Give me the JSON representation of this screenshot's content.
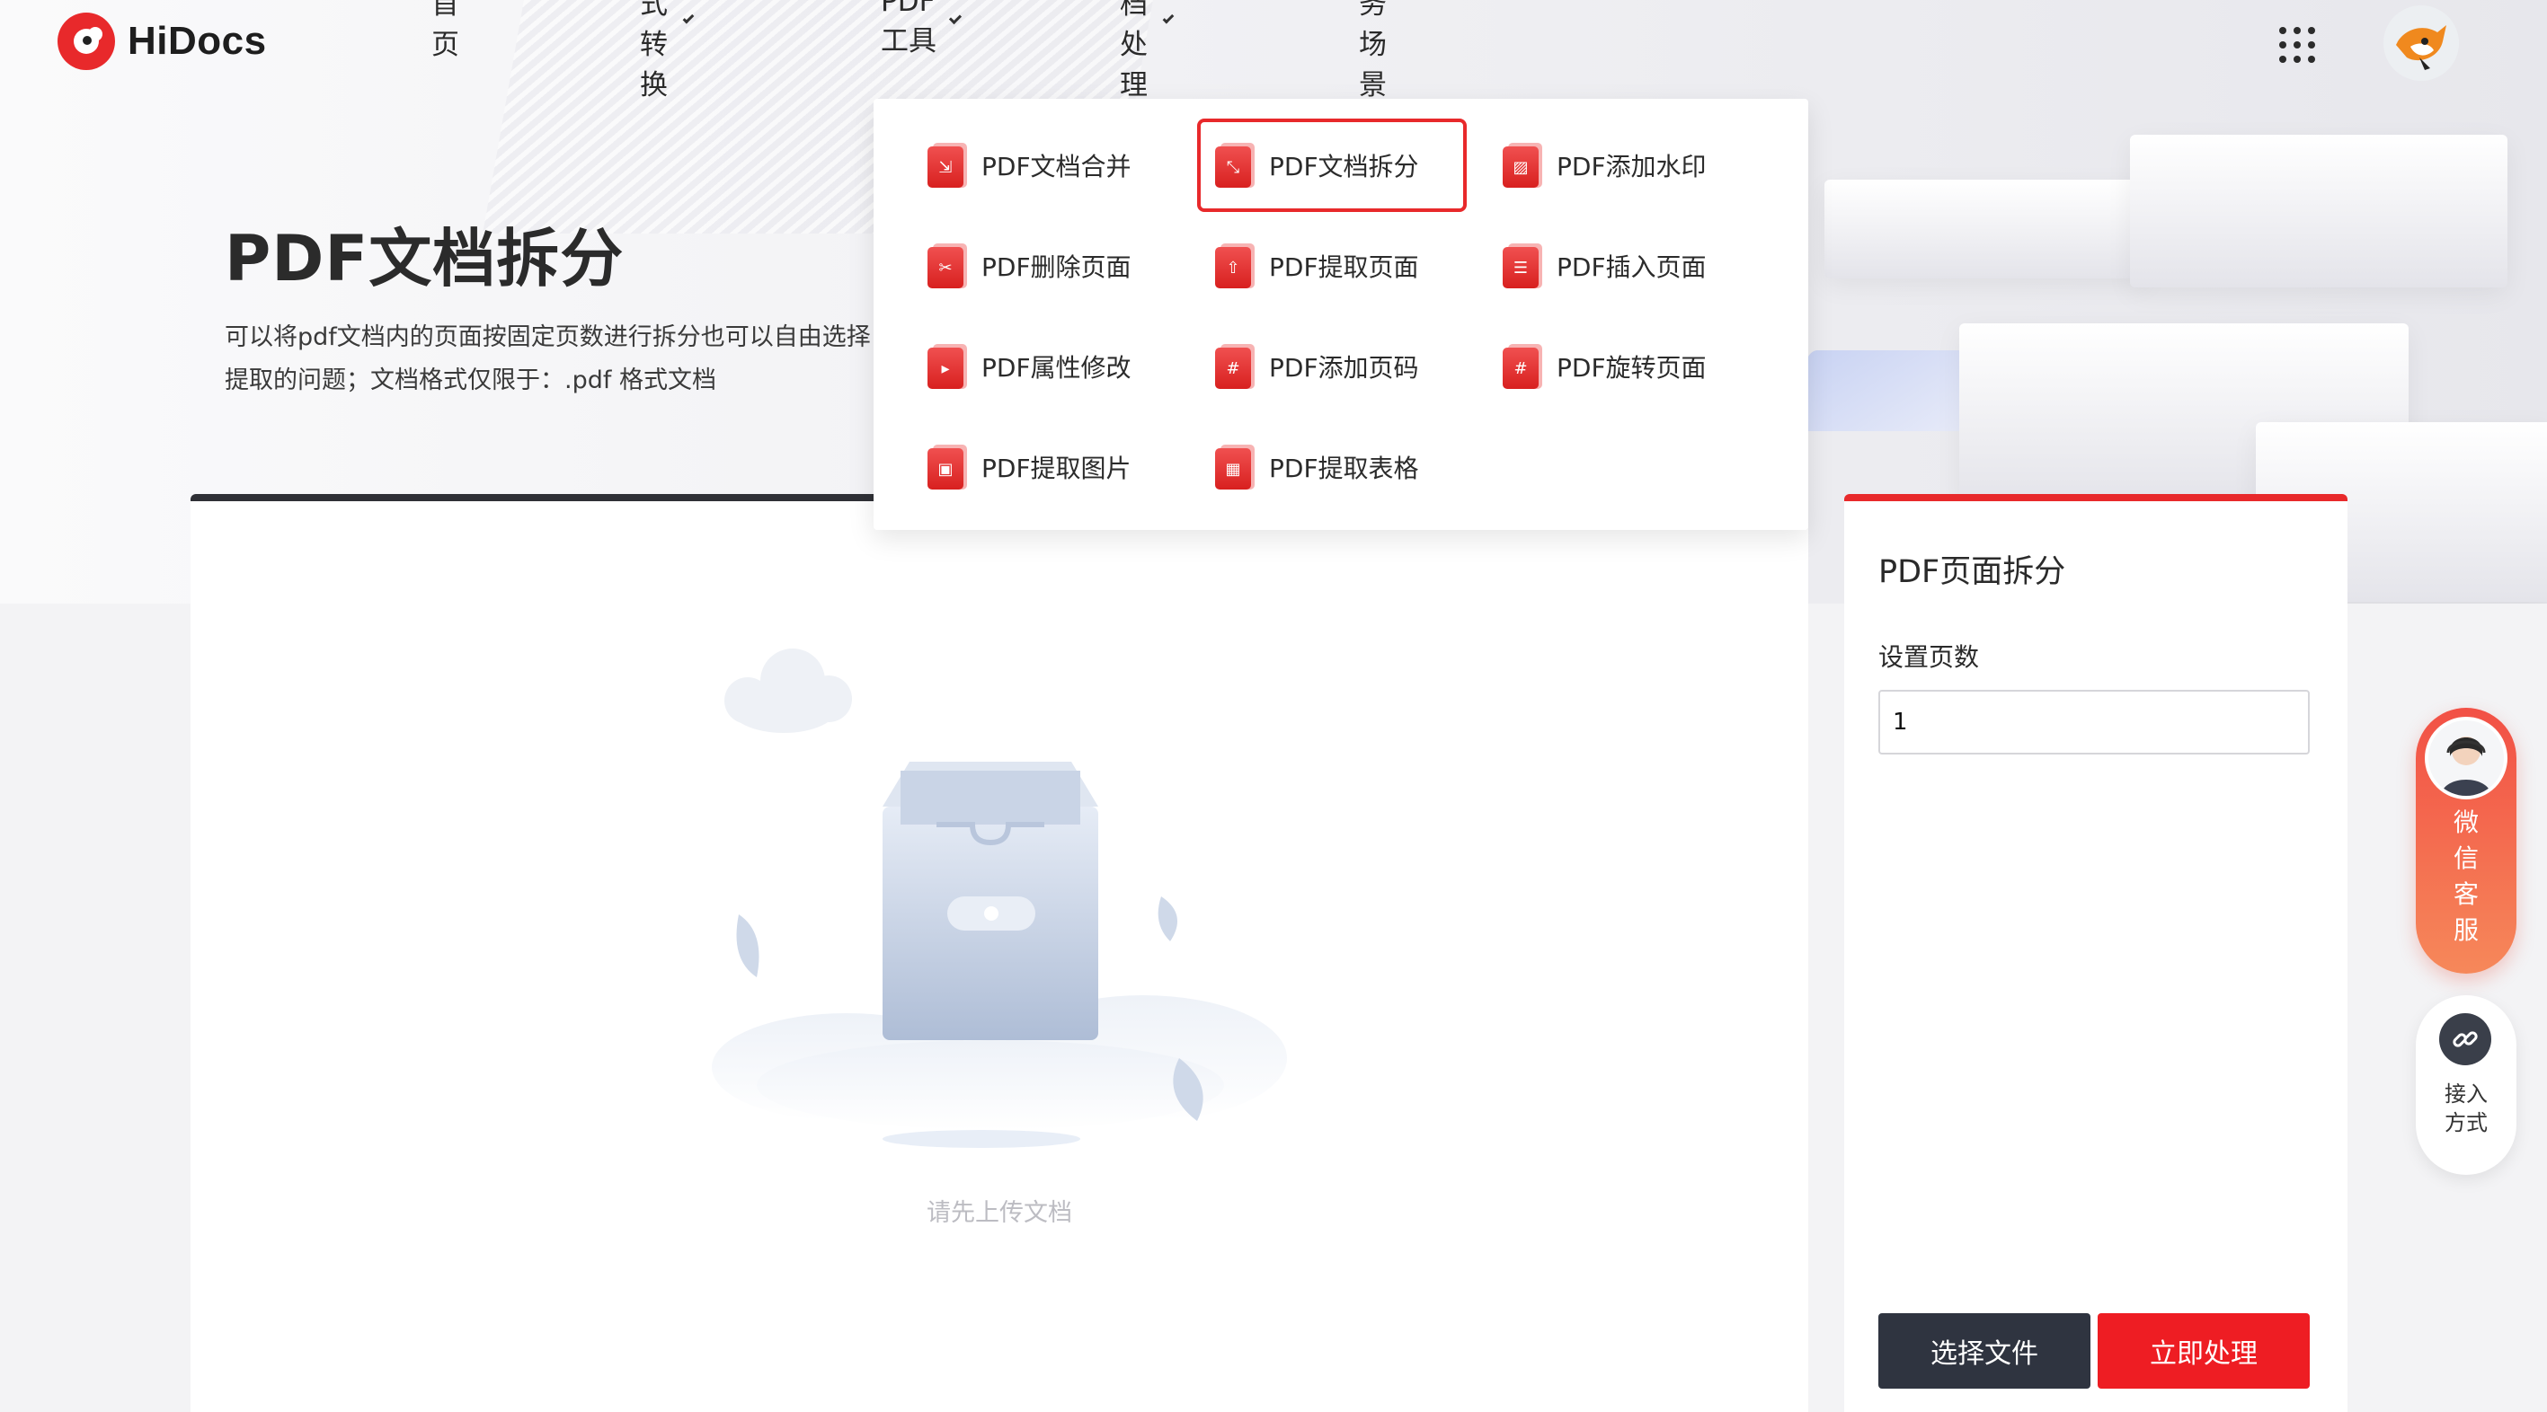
{
  "header": {
    "logo_text": "HiDocs",
    "nav": [
      {
        "label": "首页",
        "has_dropdown": false
      },
      {
        "label": "格式转换",
        "has_dropdown": true
      },
      {
        "label": "PDF工具",
        "has_dropdown": true
      },
      {
        "label": "文档处理",
        "has_dropdown": true
      },
      {
        "label": "服务场景",
        "has_dropdown": false
      }
    ],
    "apps_icon": "grid-icon",
    "avatar_icon": "user-avatar"
  },
  "hero": {
    "title": "PDF文档拆分",
    "desc_line1": "可以将pdf文档内的页面按固定页数进行拆分也可以自由选择",
    "desc_line2": "提取的问题；文档格式仅限于：.pdf 格式文档"
  },
  "pdf_tools_menu": {
    "items": [
      {
        "label": "PDF文档合并",
        "icon": "merge-icon",
        "glyph": "⇲"
      },
      {
        "label": "PDF文档拆分",
        "icon": "split-icon",
        "glyph": "⤡",
        "active": true
      },
      {
        "label": "PDF添加水印",
        "icon": "watermark-icon",
        "glyph": "▨"
      },
      {
        "label": "PDF删除页面",
        "icon": "delete-page-icon",
        "glyph": "✂"
      },
      {
        "label": "PDF提取页面",
        "icon": "extract-page-icon",
        "glyph": "⇧"
      },
      {
        "label": "PDF插入页面",
        "icon": "insert-page-icon",
        "glyph": "☰"
      },
      {
        "label": "PDF属性修改",
        "icon": "properties-icon",
        "glyph": "▸"
      },
      {
        "label": "PDF添加页码",
        "icon": "page-number-icon",
        "glyph": "#"
      },
      {
        "label": "PDF旋转页面",
        "icon": "rotate-page-icon",
        "glyph": "#"
      },
      {
        "label": "PDF提取图片",
        "icon": "extract-image-icon",
        "glyph": "▣"
      },
      {
        "label": "PDF提取表格",
        "icon": "extract-table-icon",
        "glyph": "▦"
      }
    ]
  },
  "upload": {
    "empty_text": "请先上传文档"
  },
  "settings": {
    "title": "PDF页面拆分",
    "pages_label": "设置页数",
    "pages_value": "1",
    "choose_button": "选择文件",
    "process_button": "立即处理"
  },
  "floating": {
    "service_label": "微信客服",
    "service_chars": [
      "微",
      "信",
      "客",
      "服"
    ],
    "connect_line1": "接入",
    "connect_line2": "方式"
  },
  "colors": {
    "brand_red": "#e8292b",
    "dark_button": "#2f3440",
    "process_button": "#ee1d23"
  }
}
